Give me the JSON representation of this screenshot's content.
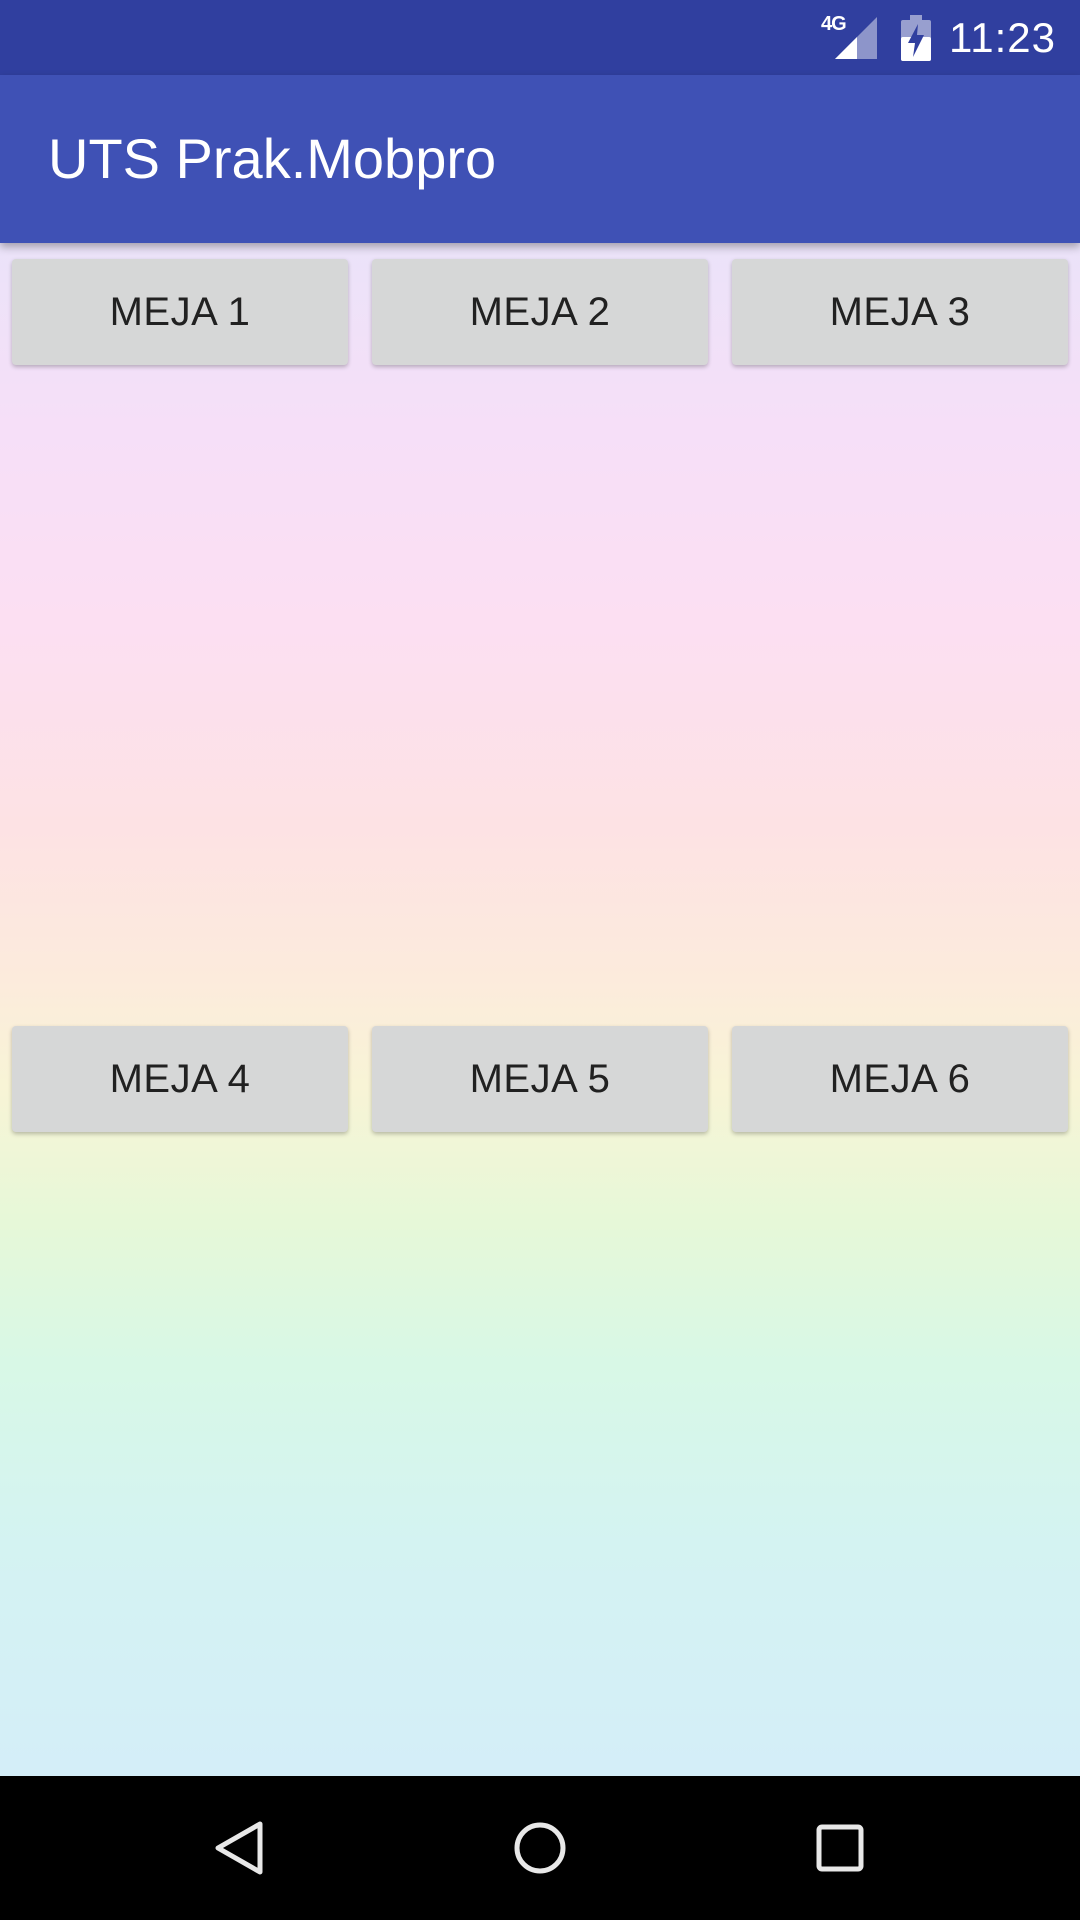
{
  "status_bar": {
    "network_type": "4G",
    "time": "11:23",
    "icons": [
      "signal-icon",
      "battery-charging-icon"
    ]
  },
  "app_bar": {
    "title": "UTS Prak.Mobpro"
  },
  "tables": {
    "row1": [
      {
        "label": "MEJA 1"
      },
      {
        "label": "MEJA 2"
      },
      {
        "label": "MEJA 3"
      }
    ],
    "row2": [
      {
        "label": "MEJA 4"
      },
      {
        "label": "MEJA 5"
      },
      {
        "label": "MEJA 6"
      }
    ]
  },
  "nav_bar": {
    "icons": [
      "back-icon",
      "home-icon",
      "recent-apps-icon"
    ]
  },
  "colors": {
    "status_bar": "#303f9f",
    "app_bar": "#3f51b5",
    "button": "#d6d7d7",
    "button_text": "#212121"
  }
}
